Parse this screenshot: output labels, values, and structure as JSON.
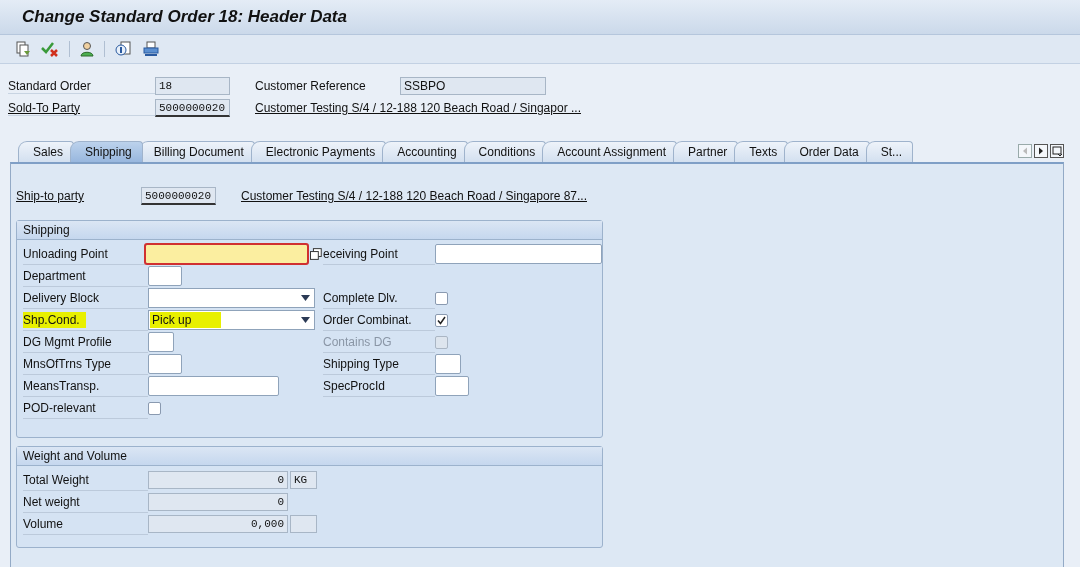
{
  "window": {
    "title": "Change Standard Order 18: Header Data"
  },
  "header": {
    "standard_order": {
      "label": "Standard Order",
      "value": "18"
    },
    "customer_reference": {
      "label": "Customer Reference",
      "value": "SSBPO"
    },
    "sold_to": {
      "label": "Sold-To Party",
      "value": "5000000020",
      "description": "Customer Testing S/4 / 12-188 120 Beach Road / Singapor ..."
    }
  },
  "tabs": [
    {
      "label": "Sales",
      "selected": false
    },
    {
      "label": "Shipping",
      "selected": true
    },
    {
      "label": "Billing Document",
      "selected": false
    },
    {
      "label": "Electronic Payments",
      "selected": false
    },
    {
      "label": "Accounting",
      "selected": false
    },
    {
      "label": "Conditions",
      "selected": false
    },
    {
      "label": "Account Assignment",
      "selected": false
    },
    {
      "label": "Partner",
      "selected": false
    },
    {
      "label": "Texts",
      "selected": false
    },
    {
      "label": "Order Data",
      "selected": false
    },
    {
      "label": "St...",
      "selected": false
    }
  ],
  "ship_to": {
    "label": "Ship-to party",
    "value": "5000000020",
    "description": "Customer Testing S/4 / 12-188 120 Beach Road / Singapore 87..."
  },
  "shipping": {
    "title": "Shipping",
    "rows": [
      {
        "left": {
          "label": "Unloading Point",
          "kind": "wide",
          "focused": true
        },
        "right": {
          "label": "eceiving Point",
          "kind": "wide"
        }
      },
      {
        "left": {
          "label": "Department",
          "kind": "short"
        }
      },
      {
        "left": {
          "label": "Delivery Block",
          "kind": "dropdown"
        },
        "right": {
          "label": "Complete Dlv.",
          "kind": "checkbox",
          "checked": false,
          "disabled": false
        }
      },
      {
        "left": {
          "label": "Shp.Cond.",
          "kind": "dropdown",
          "value": "Pick up",
          "highlighted": true
        },
        "right": {
          "label": "Order Combinat.",
          "kind": "checkbox",
          "checked": true,
          "disabled": false
        }
      },
      {
        "left": {
          "label": "DG Mgmt Profile",
          "kind": "tiny"
        },
        "right": {
          "label": "Contains DG",
          "kind": "checkbox",
          "checked": false,
          "disabled": true
        }
      },
      {
        "left": {
          "label": "MnsOfTrns Type",
          "kind": "short"
        },
        "right": {
          "label": "Shipping Type",
          "kind": "tiny"
        }
      },
      {
        "left": {
          "label": "MeansTransp.",
          "kind": "medium"
        },
        "right": {
          "label": "SpecProcId",
          "kind": "short"
        }
      },
      {
        "left": {
          "label": "POD-relevant",
          "kind": "checkbox",
          "checked": false,
          "disabled": false
        }
      }
    ]
  },
  "weight": {
    "title": "Weight and Volume",
    "rows": [
      {
        "label": "Total Weight",
        "value": "0",
        "unit_box": true,
        "unit": "KG"
      },
      {
        "label": "Net weight",
        "value": "0"
      },
      {
        "label": "Volume",
        "value": "0,000",
        "unit_box": true
      }
    ]
  }
}
